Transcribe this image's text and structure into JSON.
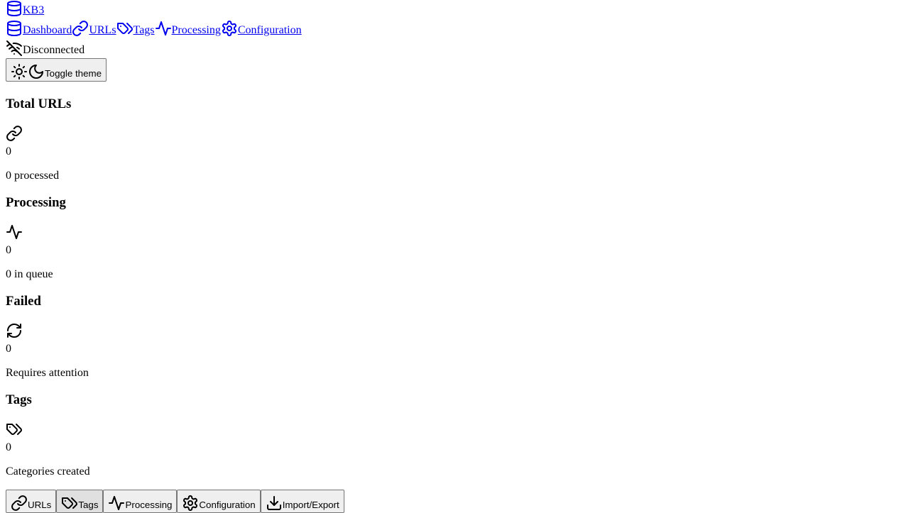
{
  "brand": {
    "name": "KB3",
    "icon": "database-icon"
  },
  "nav": [
    {
      "label": "Dashboard",
      "icon": "database-icon"
    },
    {
      "label": "URLs",
      "icon": "link-icon"
    },
    {
      "label": "Tags",
      "icon": "tags-icon"
    },
    {
      "label": "Processing",
      "icon": "activity-icon"
    },
    {
      "label": "Configuration",
      "icon": "gear-icon"
    }
  ],
  "status": {
    "label": "Disconnected",
    "icon": "wifi-off-icon"
  },
  "theme_toggle": {
    "label": "Toggle theme"
  },
  "cards": [
    {
      "title": "Total URLs",
      "icon": "link-icon",
      "value": "0",
      "note": "0 processed"
    },
    {
      "title": "Processing",
      "icon": "activity-icon",
      "value": "0",
      "note": "0 in queue"
    },
    {
      "title": "Failed",
      "icon": "refresh-icon",
      "value": "0",
      "note": "Requires attention"
    },
    {
      "title": "Tags",
      "icon": "tags-icon",
      "value": "0",
      "note": "Categories created"
    }
  ],
  "actions": [
    {
      "label": "URLs",
      "icon": "link-icon"
    },
    {
      "label": "Tags",
      "icon": "tags-icon"
    },
    {
      "label": "Processing",
      "icon": "activity-icon"
    },
    {
      "label": "Configuration",
      "icon": "gear-icon"
    },
    {
      "label": "Import/Export",
      "icon": "download-icon"
    }
  ]
}
